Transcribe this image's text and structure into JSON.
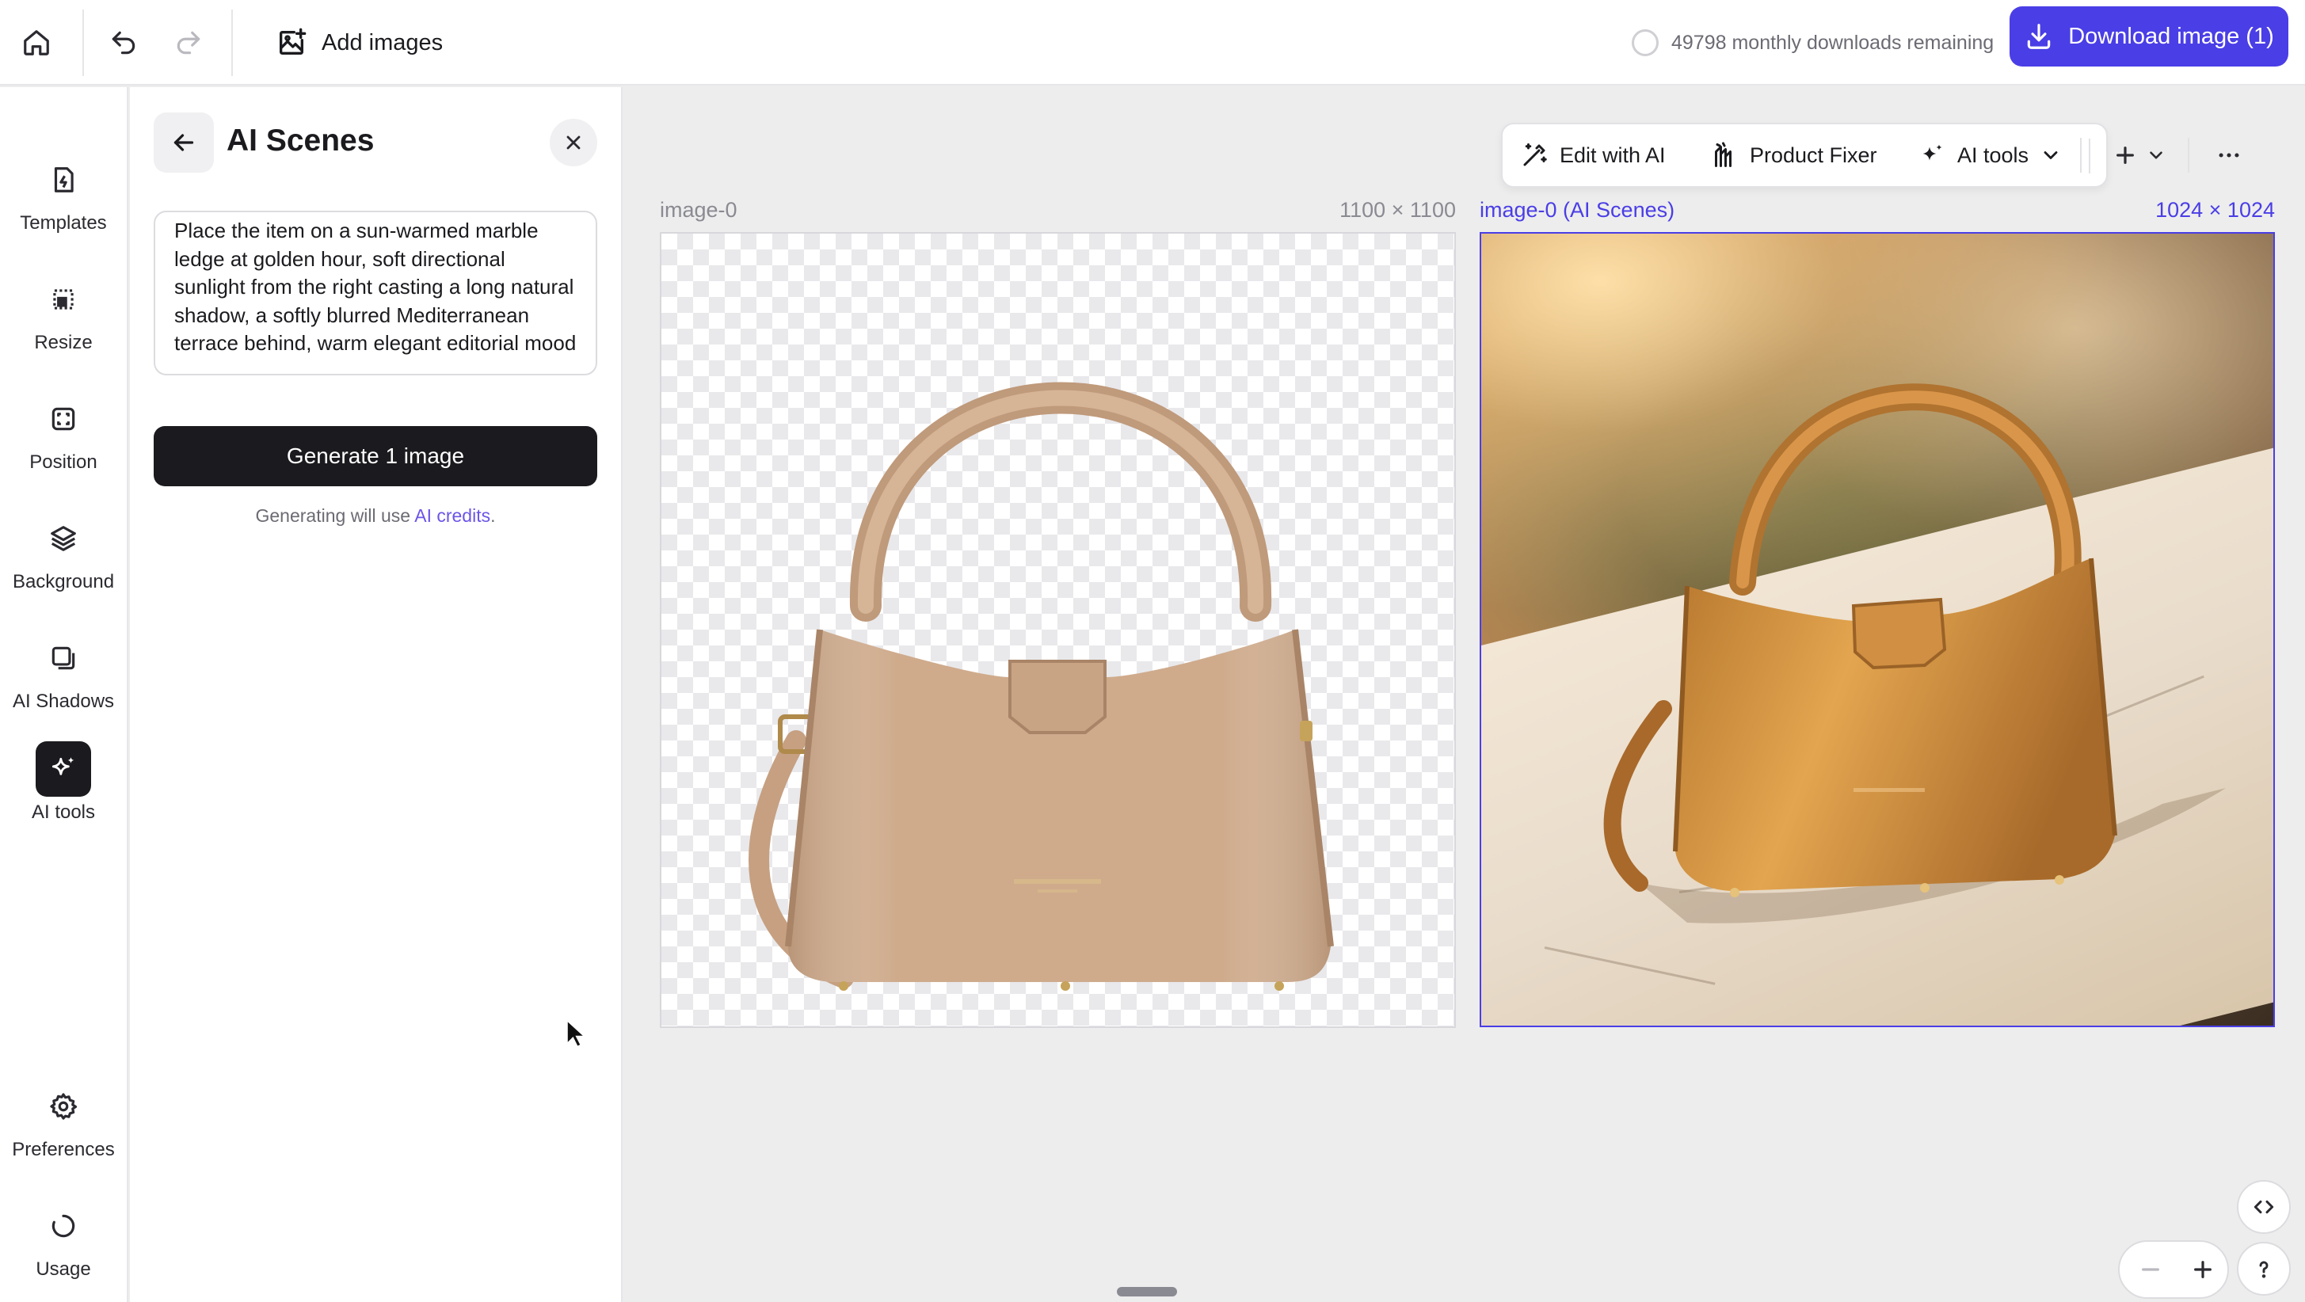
{
  "topbar": {
    "home_icon": "home-icon",
    "undo_icon": "undo-icon",
    "redo_icon": "redo-icon",
    "add_images_label": "Add images",
    "downloads_remaining": "49798 monthly downloads remaining",
    "download_button_label": "Download image (1)"
  },
  "rail": {
    "items": [
      {
        "label": "Templates",
        "icon": "templates-icon"
      },
      {
        "label": "Resize",
        "icon": "resize-icon"
      },
      {
        "label": "Position",
        "icon": "position-icon"
      },
      {
        "label": "Background",
        "icon": "layers-icon"
      },
      {
        "label": "AI Shadows",
        "icon": "shadow-icon"
      },
      {
        "label": "AI tools",
        "icon": "sparkle-icon",
        "active": true
      },
      {
        "label": "Preferences",
        "icon": "gear-icon"
      },
      {
        "label": "Usage",
        "icon": "usage-icon"
      }
    ]
  },
  "panel": {
    "title": "AI Scenes",
    "prompt_value": "Place the item on a sun-warmed marble ledge at golden hour, soft directional sunlight from the right casting a long natural shadow, a softly blurred Mediterranean terrace behind, warm elegant editorial mood",
    "generate_label": "Generate 1 image",
    "credits_prefix": "Generating will use ",
    "credits_link": "AI credits",
    "credits_suffix": "."
  },
  "toolbar": {
    "edit_with_ai": "Edit with AI",
    "product_fixer": "Product Fixer",
    "ai_tools": "AI tools"
  },
  "images": [
    {
      "name": "image-0",
      "dimensions": "1100 × 1100"
    },
    {
      "name": "image-0 (AI Scenes)",
      "dimensions": "1024 × 1024",
      "selected": true
    }
  ],
  "colors": {
    "accent": "#4a3ee6",
    "dark_button": "#1b1b1f",
    "link": "#6b55e8",
    "bag_tan": "#cfaa8a",
    "bag_gold": "#d99a45"
  }
}
